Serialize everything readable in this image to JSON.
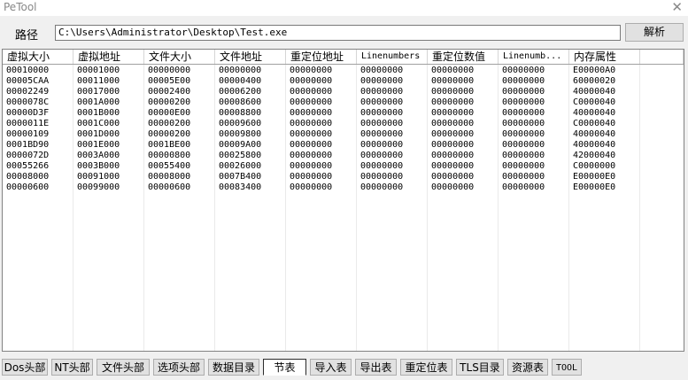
{
  "window": {
    "title": "PeTool",
    "close_glyph": "✕"
  },
  "path": {
    "label": "路径",
    "value": "C:\\Users\\Administrator\\Desktop\\Test.exe"
  },
  "parse_button": "解析",
  "table": {
    "columns": [
      "虚拟大小",
      "虚拟地址",
      "文件大小",
      "文件地址",
      "重定位地址",
      "Linenumbers",
      "重定位数值",
      "Linenumb...",
      "内存属性"
    ],
    "rows": [
      [
        "00010000",
        "00001000",
        "00000000",
        "00000000",
        "00000000",
        "00000000",
        "00000000",
        "00000000",
        "E00000A0"
      ],
      [
        "00005CAA",
        "00011000",
        "00005E00",
        "00000400",
        "00000000",
        "00000000",
        "00000000",
        "00000000",
        "60000020"
      ],
      [
        "00002249",
        "00017000",
        "00002400",
        "00006200",
        "00000000",
        "00000000",
        "00000000",
        "00000000",
        "40000040"
      ],
      [
        "0000078C",
        "0001A000",
        "00000200",
        "00008600",
        "00000000",
        "00000000",
        "00000000",
        "00000000",
        "C0000040"
      ],
      [
        "00000D3F",
        "0001B000",
        "00000E00",
        "00008800",
        "00000000",
        "00000000",
        "00000000",
        "00000000",
        "40000040"
      ],
      [
        "0000011E",
        "0001C000",
        "00000200",
        "00009600",
        "00000000",
        "00000000",
        "00000000",
        "00000000",
        "C0000040"
      ],
      [
        "00000109",
        "0001D000",
        "00000200",
        "00009800",
        "00000000",
        "00000000",
        "00000000",
        "00000000",
        "40000040"
      ],
      [
        "0001BD90",
        "0001E000",
        "0001BE00",
        "00009A00",
        "00000000",
        "00000000",
        "00000000",
        "00000000",
        "40000040"
      ],
      [
        "0000072D",
        "0003A000",
        "00000800",
        "00025800",
        "00000000",
        "00000000",
        "00000000",
        "00000000",
        "42000040"
      ],
      [
        "00055266",
        "0003B000",
        "00055400",
        "00026000",
        "00000000",
        "00000000",
        "00000000",
        "00000000",
        "C0000000"
      ],
      [
        "00008000",
        "00091000",
        "00008000",
        "0007B400",
        "00000000",
        "00000000",
        "00000000",
        "00000000",
        "E00000E0"
      ],
      [
        "00000600",
        "00099000",
        "00000600",
        "00083400",
        "00000000",
        "00000000",
        "00000000",
        "00000000",
        "E00000E0"
      ]
    ]
  },
  "tabs": [
    {
      "label": "Dos头部",
      "active": false
    },
    {
      "label": "NT头部",
      "active": false
    },
    {
      "label": "文件头部",
      "active": false
    },
    {
      "label": "选项头部",
      "active": false
    },
    {
      "label": "数据目录",
      "active": false
    },
    {
      "label": "节表",
      "active": true
    },
    {
      "label": "导入表",
      "active": false
    },
    {
      "label": "导出表",
      "active": false
    },
    {
      "label": "重定位表",
      "active": false
    },
    {
      "label": "TLS目录",
      "active": false
    },
    {
      "label": "资源表",
      "active": false
    },
    {
      "label": "TOOL",
      "active": false
    }
  ]
}
